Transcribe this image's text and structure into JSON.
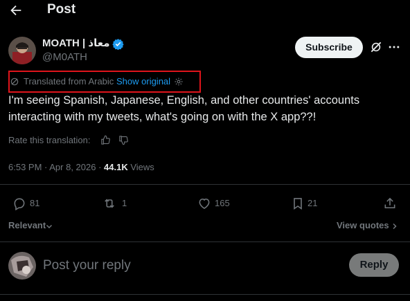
{
  "header": {
    "title": "Post"
  },
  "post": {
    "author": {
      "display_name": "MOATH | معاذ",
      "handle": "@M0ATH"
    },
    "subscribe_label": "Subscribe",
    "translation": {
      "label": "Translated from Arabic",
      "show_original": "Show original"
    },
    "text": "I'm seeing Spanish, Japanese, English, and other countries' accounts interacting with my tweets, what's going on with the X app??!",
    "rate_label": "Rate this translation:",
    "timestamp": "6:53 PM · Apr 8, 2026 · ",
    "views_count": "44.1K",
    "views_label": " Views",
    "actions": {
      "replies": "81",
      "reposts": "1",
      "likes": "165",
      "bookmarks": "21"
    }
  },
  "sort": {
    "label": "Relevant",
    "view_quotes": "View quotes"
  },
  "reply": {
    "placeholder": "Post your reply",
    "button": "Reply"
  },
  "colors": {
    "accent": "#1d9bf0",
    "highlight": "#e0141b",
    "text": "#e7e9ea",
    "muted": "#71767b",
    "background": "#000000"
  }
}
